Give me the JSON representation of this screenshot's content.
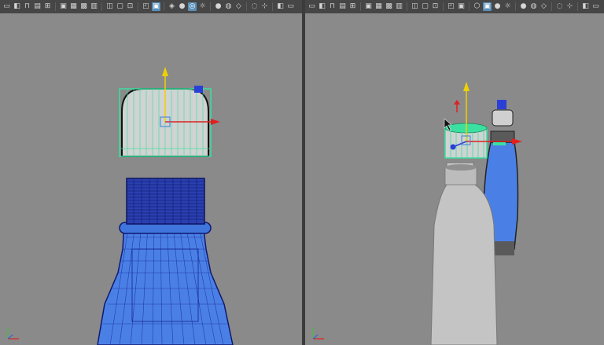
{
  "app": {
    "name": "3D modeling application"
  },
  "colors": {
    "viewport_bg": "#8a8a8a",
    "toolbar_bg": "#464646",
    "wire_blue": "#1a2fa0",
    "mesh_blue": "#4a80e6",
    "selection_green": "#3be0a0",
    "cap_fill": "#cfd3d2",
    "bottle_gray": "#c8c8c8",
    "axis_x": "#e02020",
    "axis_y": "#f0d000",
    "axis_z": "#2a3fd6",
    "active_button": "#5a8fb8"
  },
  "viewports": [
    {
      "id": "left",
      "shading": "wireframe-on-shaded",
      "toolbar": [
        "camera-icon",
        "bookmark-icon",
        "lock-icon",
        "image-plane-icon",
        "grid-icon",
        "separator",
        "wireframe-icon",
        "smooth-shade-icon",
        "textured-icon",
        "lights-icon",
        "separator",
        "shadow-icon",
        "xray-icon",
        "isolate-icon",
        "separator",
        "camera-attr-icon",
        "frame-icon",
        "separator",
        "gate-icon",
        "xray-active-icon",
        "sun-icon",
        "separator",
        "ao-icon",
        "motion-blur-icon",
        "separator",
        "aa-icon",
        "separator",
        "panel-layout-icon",
        "view-options-icon"
      ]
    },
    {
      "id": "right",
      "shading": "smooth-shaded",
      "toolbar": [
        "camera-icon",
        "bookmark-icon",
        "lock-icon",
        "image-plane-icon",
        "grid-icon",
        "separator",
        "wireframe-icon",
        "smooth-shade-icon",
        "textured-icon",
        "lights-icon",
        "separator",
        "shadow-icon",
        "xray-icon",
        "isolate-icon",
        "separator",
        "camera-attr-icon",
        "frame-icon",
        "separator",
        "gate-icon",
        "cube-icon",
        "sun-icon",
        "separator",
        "ao-icon",
        "motion-blur-icon",
        "separator",
        "aa-icon",
        "separator",
        "panel-layout-icon",
        "view-options-icon"
      ]
    }
  ]
}
